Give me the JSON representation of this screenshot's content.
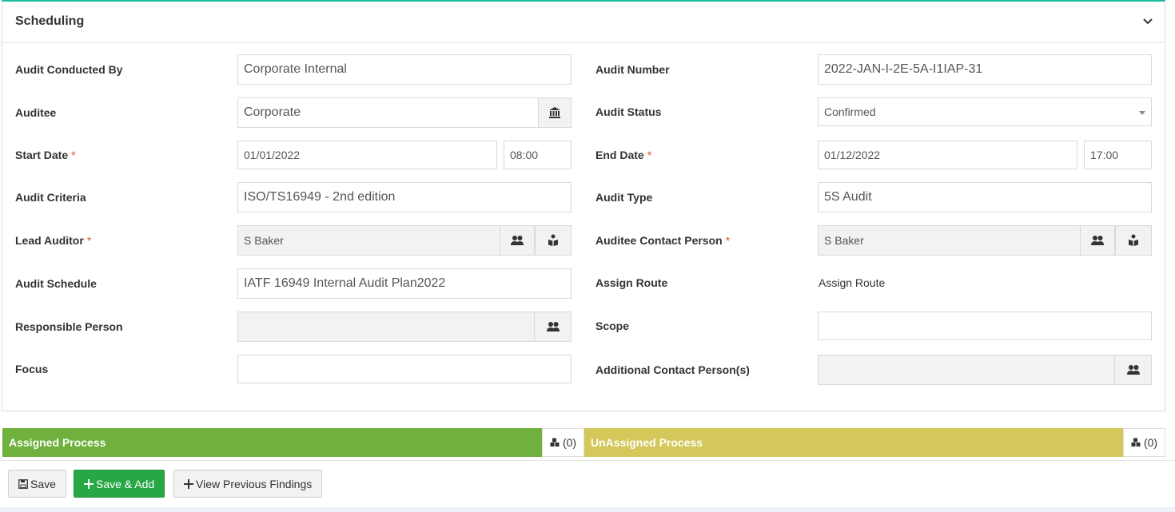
{
  "panel": {
    "title": "Scheduling"
  },
  "colors": {
    "accent": "#1abc9c",
    "assigned": "#6fb13c",
    "unassigned": "#d4c85a",
    "green_button": "#28a745",
    "required": "#e74c3c"
  },
  "left": {
    "conducted_by": {
      "label": "Audit Conducted By",
      "value": "Corporate Internal"
    },
    "auditee": {
      "label": "Auditee",
      "value": "Corporate",
      "icon": "building-icon"
    },
    "start_date": {
      "label": "Start Date",
      "required": "*",
      "date": "01/01/2022",
      "time": "08:00"
    },
    "criteria": {
      "label": "Audit Criteria",
      "value": "ISO/TS16949 - 2nd edition"
    },
    "lead_auditor": {
      "label": "Lead Auditor",
      "required": "*",
      "value": "S Baker"
    },
    "schedule": {
      "label": "Audit Schedule",
      "value": "IATF 16949 Internal Audit Plan2022"
    },
    "responsible": {
      "label": "Responsible Person",
      "value": ""
    },
    "focus": {
      "label": "Focus",
      "value": ""
    }
  },
  "right": {
    "number": {
      "label": "Audit Number",
      "value": "2022-JAN-I-2E-5A-I1IAP-31"
    },
    "status": {
      "label": "Audit Status",
      "value": "Confirmed"
    },
    "end_date": {
      "label": "End Date",
      "required": "*",
      "date": "01/12/2022",
      "time": "17:00"
    },
    "type": {
      "label": "Audit Type",
      "value": "5S Audit"
    },
    "contact": {
      "label": "Auditee Contact Person",
      "required": "*",
      "value": "S Baker"
    },
    "route": {
      "label": "Assign Route",
      "value": "Assign Route"
    },
    "scope": {
      "label": "Scope",
      "value": ""
    },
    "additional": {
      "label": "Additional Contact Person(s)",
      "value": ""
    }
  },
  "process": {
    "assigned": {
      "label": "Assigned Process",
      "count": "(0)"
    },
    "unassigned": {
      "label": "UnAssigned Process",
      "count": "(0)"
    }
  },
  "buttons": {
    "save": "Save",
    "save_add": "Save & Add",
    "previous": "View Previous Findings"
  }
}
